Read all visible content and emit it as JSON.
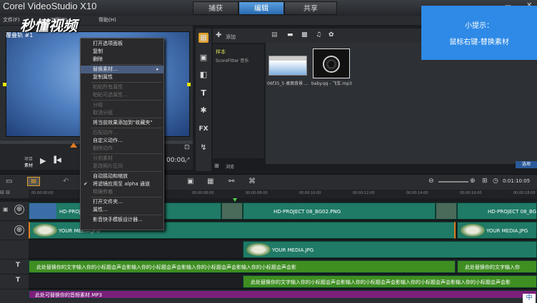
{
  "window": {
    "title": "Corel VideoStudio X10",
    "tabs": [
      {
        "label": "捕获"
      },
      {
        "label": "编辑"
      },
      {
        "label": "共享"
      }
    ]
  },
  "menubar": {
    "items": [
      "文件(F)",
      "工程(P)",
      "帮助(H)"
    ]
  },
  "watermark": "秒懂视频",
  "preview": {
    "label": "覆叠轨 #1"
  },
  "library": {
    "add_label": "添加",
    "list_items": [
      "样本",
      "ScoreFitter 音乐"
    ],
    "browse_label": "浏览",
    "files": [
      {
        "label": "06f35_5 桌面背景 ..."
      },
      {
        "label": "baby.qq - 飞车.mp3"
      }
    ],
    "options_label": "选项"
  },
  "hint": {
    "title": "小提示：",
    "text": "鼠标右键-替换素材"
  },
  "playbar": {
    "project_label": "项目",
    "clip_label": "素材",
    "timecode": "00:00"
  },
  "context_menu": {
    "items": [
      {
        "label": "打开选项面板",
        "disabled": false
      },
      {
        "label": "复制",
        "disabled": false
      },
      {
        "label": "删除",
        "disabled": false
      },
      {
        "label": "替换素材...",
        "disabled": false,
        "highlight": true,
        "submenu": true
      },
      {
        "label": "复制属性",
        "disabled": false
      },
      {
        "label": "粘贴所有属性",
        "disabled": true
      },
      {
        "label": "粘贴可选属性...",
        "disabled": true
      },
      {
        "label": "分组",
        "disabled": true
      },
      {
        "label": "取消分组",
        "disabled": true
      },
      {
        "label": "将当前效果添加到\"收藏夹\"",
        "disabled": false
      },
      {
        "label": "匹配动作...",
        "disabled": true
      },
      {
        "label": "自定义动作...",
        "disabled": false
      },
      {
        "label": "删除动作",
        "disabled": true
      },
      {
        "label": "分割素材",
        "disabled": true
      },
      {
        "label": "更改照片区间",
        "disabled": true
      },
      {
        "label": "自动摇动和缩放",
        "disabled": false
      },
      {
        "label": "将滤镜应用至 alpha 通道",
        "disabled": false,
        "checked": true
      },
      {
        "label": "精确剪裁",
        "disabled": true
      },
      {
        "label": "打开文件夹...",
        "disabled": false
      },
      {
        "label": "属性...",
        "disabled": false
      },
      {
        "label": "影音快手模板设计器...",
        "disabled": false
      }
    ]
  },
  "timeline": {
    "ruler": [
      "00:00:00:00",
      "00:00:02:00",
      "00:00:04:00",
      "00:00:06:00",
      "00:00:08:00",
      "00:00:10:00",
      "00:00:12:00",
      "00:00:14:00",
      "00:00:16:00",
      "00:00:18:00"
    ],
    "timecode": "0:01:10:05",
    "tracks": {
      "video": [
        {
          "label": "HD-PROJECT 08_BG02.PNG"
        },
        {
          "label": "HD-PROJECT 08_BG02.PNG"
        },
        {
          "label": "HD-PROJECT 08_BG"
        }
      ],
      "overlay1": [
        {
          "label": "YOUR MEDIA.JPG"
        },
        {
          "label": "YOUR MEDIA.JPG"
        }
      ],
      "overlay2": [
        {
          "label": "YOUR MEDIA.JPG"
        }
      ],
      "title1": [
        {
          "label": "此处替换你的文字输入你的小标题会声会影输入你的小标题会声会影输入你的小标题会声会影输入你的小标题会声会影"
        },
        {
          "label": "此处替换你的文字输入你"
        }
      ],
      "title2": [
        {
          "label": "此处替换你的文字输入你的小标题会声会影输入你的小标题会声会影输入你的小标题会声会影输入你的小标题会声会影"
        }
      ],
      "music": [
        {
          "label": "此处可替换你的音频素材.MP3"
        }
      ]
    }
  },
  "ime_indicator": "中"
}
